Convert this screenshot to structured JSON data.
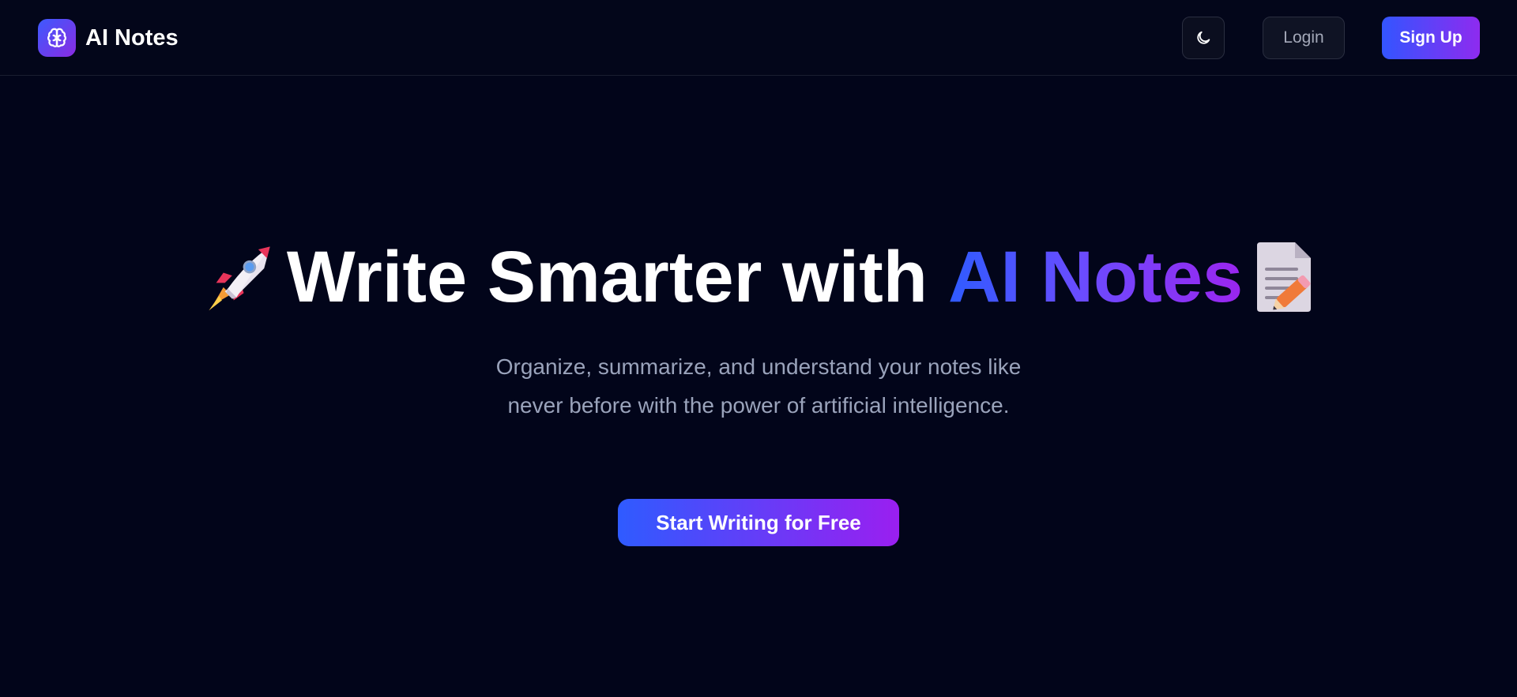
{
  "app": {
    "name": "AI Notes",
    "logo_icon": "brain-icon",
    "colors": {
      "background": "#02051a",
      "accent_start": "#3355ff",
      "accent_end": "#8e2bef"
    }
  },
  "header": {
    "theme_toggle_icon": "moon-icon",
    "login_label": "Login",
    "signup_label": "Sign Up"
  },
  "hero": {
    "title_prefix": "Write Smarter with",
    "title_highlight": "AI Notes",
    "leading_icon": "rocket-icon",
    "trailing_icon": "memo-icon",
    "subtitle": "Organize, summarize, and understand your notes like never before with the power of artificial intelligence.",
    "cta_label": "Start Writing for Free"
  }
}
